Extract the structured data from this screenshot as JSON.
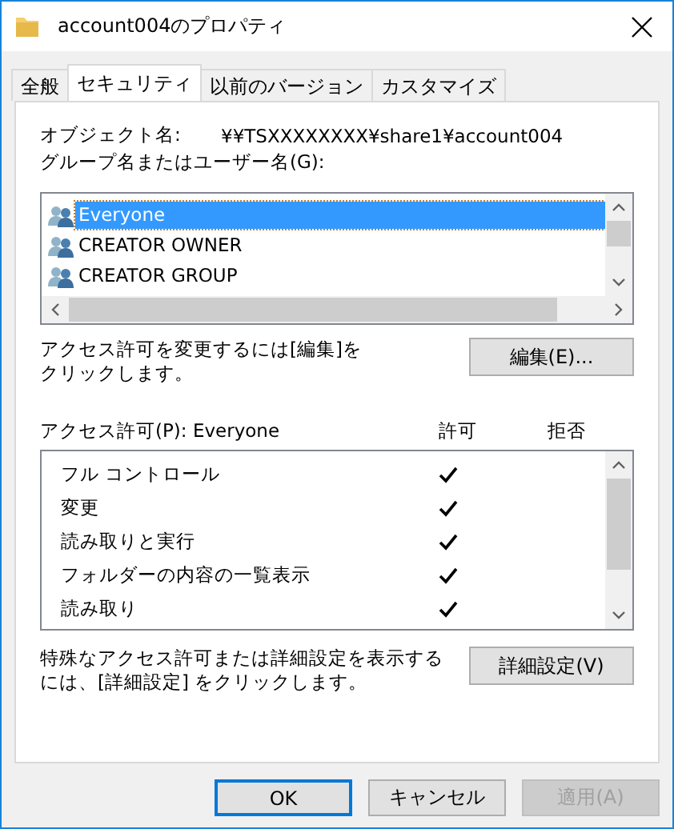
{
  "window": {
    "title": "account004のプロパティ"
  },
  "tabs": [
    {
      "label": "全般",
      "selected": false
    },
    {
      "label": "セキュリティ",
      "selected": true
    },
    {
      "label": "以前のバージョン",
      "selected": false
    },
    {
      "label": "カスタマイズ",
      "selected": false
    }
  ],
  "object_label": "オブジェクト名:",
  "object_value": "¥¥TSXXXXXXXX¥share1¥account004",
  "groups_label": "グループ名またはユーザー名(G):",
  "groups": [
    {
      "name": "Everyone",
      "selected": true
    },
    {
      "name": "CREATOR OWNER",
      "selected": false
    },
    {
      "name": "CREATOR GROUP",
      "selected": false
    }
  ],
  "edit_note": [
    "アクセス許可を変更するには[編集]を",
    "クリックします。"
  ],
  "edit_button": "編集(E)...",
  "permissions_label": "アクセス許可(P): Everyone",
  "allow_header": "許可",
  "deny_header": "拒否",
  "permissions": [
    {
      "name": "フル コントロール",
      "allow": true,
      "deny": false
    },
    {
      "name": "変更",
      "allow": true,
      "deny": false
    },
    {
      "name": "読み取りと実行",
      "allow": true,
      "deny": false
    },
    {
      "name": "フォルダーの内容の一覧表示",
      "allow": true,
      "deny": false
    },
    {
      "name": "読み取り",
      "allow": true,
      "deny": false
    }
  ],
  "advanced_note": [
    "特殊なアクセス許可または詳細設定を表示する",
    "には、[詳細設定] をクリックします。"
  ],
  "advanced_button": "詳細設定(V)",
  "buttons": [
    {
      "label": "OK",
      "disabled": false,
      "default": true
    },
    {
      "label": "キャンセル",
      "disabled": false,
      "default": false
    },
    {
      "label": "適用(A)",
      "disabled": true,
      "default": false
    }
  ]
}
